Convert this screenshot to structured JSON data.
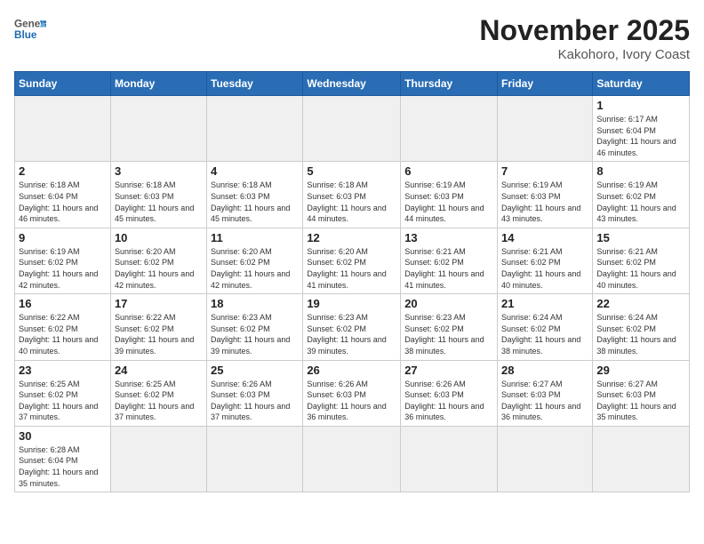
{
  "header": {
    "logo_general": "General",
    "logo_blue": "Blue",
    "month_title": "November 2025",
    "location": "Kakohoro, Ivory Coast"
  },
  "weekdays": [
    "Sunday",
    "Monday",
    "Tuesday",
    "Wednesday",
    "Thursday",
    "Friday",
    "Saturday"
  ],
  "days": [
    {
      "date": "",
      "info": ""
    },
    {
      "date": "",
      "info": ""
    },
    {
      "date": "",
      "info": ""
    },
    {
      "date": "",
      "info": ""
    },
    {
      "date": "",
      "info": ""
    },
    {
      "date": "",
      "info": ""
    },
    {
      "date": "1",
      "info": "Sunrise: 6:17 AM\nSunset: 6:04 PM\nDaylight: 11 hours and 46 minutes."
    },
    {
      "date": "2",
      "info": "Sunrise: 6:18 AM\nSunset: 6:04 PM\nDaylight: 11 hours and 46 minutes."
    },
    {
      "date": "3",
      "info": "Sunrise: 6:18 AM\nSunset: 6:03 PM\nDaylight: 11 hours and 45 minutes."
    },
    {
      "date": "4",
      "info": "Sunrise: 6:18 AM\nSunset: 6:03 PM\nDaylight: 11 hours and 45 minutes."
    },
    {
      "date": "5",
      "info": "Sunrise: 6:18 AM\nSunset: 6:03 PM\nDaylight: 11 hours and 44 minutes."
    },
    {
      "date": "6",
      "info": "Sunrise: 6:19 AM\nSunset: 6:03 PM\nDaylight: 11 hours and 44 minutes."
    },
    {
      "date": "7",
      "info": "Sunrise: 6:19 AM\nSunset: 6:03 PM\nDaylight: 11 hours and 43 minutes."
    },
    {
      "date": "8",
      "info": "Sunrise: 6:19 AM\nSunset: 6:02 PM\nDaylight: 11 hours and 43 minutes."
    },
    {
      "date": "9",
      "info": "Sunrise: 6:19 AM\nSunset: 6:02 PM\nDaylight: 11 hours and 42 minutes."
    },
    {
      "date": "10",
      "info": "Sunrise: 6:20 AM\nSunset: 6:02 PM\nDaylight: 11 hours and 42 minutes."
    },
    {
      "date": "11",
      "info": "Sunrise: 6:20 AM\nSunset: 6:02 PM\nDaylight: 11 hours and 42 minutes."
    },
    {
      "date": "12",
      "info": "Sunrise: 6:20 AM\nSunset: 6:02 PM\nDaylight: 11 hours and 41 minutes."
    },
    {
      "date": "13",
      "info": "Sunrise: 6:21 AM\nSunset: 6:02 PM\nDaylight: 11 hours and 41 minutes."
    },
    {
      "date": "14",
      "info": "Sunrise: 6:21 AM\nSunset: 6:02 PM\nDaylight: 11 hours and 40 minutes."
    },
    {
      "date": "15",
      "info": "Sunrise: 6:21 AM\nSunset: 6:02 PM\nDaylight: 11 hours and 40 minutes."
    },
    {
      "date": "16",
      "info": "Sunrise: 6:22 AM\nSunset: 6:02 PM\nDaylight: 11 hours and 40 minutes."
    },
    {
      "date": "17",
      "info": "Sunrise: 6:22 AM\nSunset: 6:02 PM\nDaylight: 11 hours and 39 minutes."
    },
    {
      "date": "18",
      "info": "Sunrise: 6:23 AM\nSunset: 6:02 PM\nDaylight: 11 hours and 39 minutes."
    },
    {
      "date": "19",
      "info": "Sunrise: 6:23 AM\nSunset: 6:02 PM\nDaylight: 11 hours and 39 minutes."
    },
    {
      "date": "20",
      "info": "Sunrise: 6:23 AM\nSunset: 6:02 PM\nDaylight: 11 hours and 38 minutes."
    },
    {
      "date": "21",
      "info": "Sunrise: 6:24 AM\nSunset: 6:02 PM\nDaylight: 11 hours and 38 minutes."
    },
    {
      "date": "22",
      "info": "Sunrise: 6:24 AM\nSunset: 6:02 PM\nDaylight: 11 hours and 38 minutes."
    },
    {
      "date": "23",
      "info": "Sunrise: 6:25 AM\nSunset: 6:02 PM\nDaylight: 11 hours and 37 minutes."
    },
    {
      "date": "24",
      "info": "Sunrise: 6:25 AM\nSunset: 6:02 PM\nDaylight: 11 hours and 37 minutes."
    },
    {
      "date": "25",
      "info": "Sunrise: 6:26 AM\nSunset: 6:03 PM\nDaylight: 11 hours and 37 minutes."
    },
    {
      "date": "26",
      "info": "Sunrise: 6:26 AM\nSunset: 6:03 PM\nDaylight: 11 hours and 36 minutes."
    },
    {
      "date": "27",
      "info": "Sunrise: 6:26 AM\nSunset: 6:03 PM\nDaylight: 11 hours and 36 minutes."
    },
    {
      "date": "28",
      "info": "Sunrise: 6:27 AM\nSunset: 6:03 PM\nDaylight: 11 hours and 36 minutes."
    },
    {
      "date": "29",
      "info": "Sunrise: 6:27 AM\nSunset: 6:03 PM\nDaylight: 11 hours and 35 minutes."
    },
    {
      "date": "30",
      "info": "Sunrise: 6:28 AM\nSunset: 6:04 PM\nDaylight: 11 hours and 35 minutes."
    },
    {
      "date": "",
      "info": ""
    },
    {
      "date": "",
      "info": ""
    },
    {
      "date": "",
      "info": ""
    },
    {
      "date": "",
      "info": ""
    },
    {
      "date": "",
      "info": ""
    },
    {
      "date": "",
      "info": ""
    }
  ]
}
